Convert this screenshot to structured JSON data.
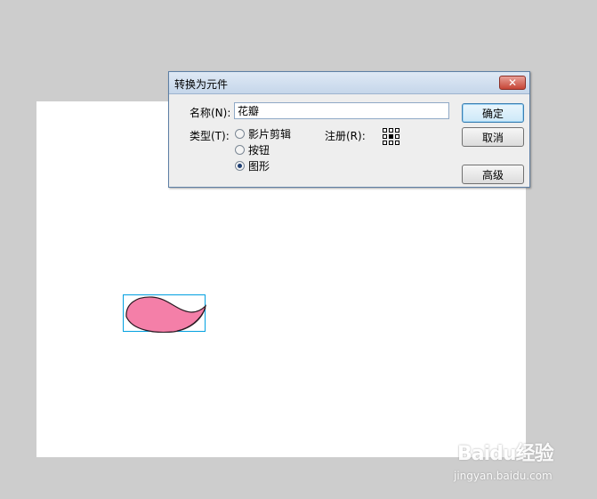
{
  "dialog": {
    "title": "转换为元件",
    "close_glyph": "✕",
    "name_label": "名称(N):",
    "name_value": "花瓣",
    "type_label": "类型(T):",
    "types": [
      {
        "label": "影片剪辑",
        "selected": false
      },
      {
        "label": "按钮",
        "selected": false
      },
      {
        "label": "图形",
        "selected": true
      }
    ],
    "registration_label": "注册(R):",
    "registration_icon": "registration-grid-icon",
    "buttons": {
      "ok": "确定",
      "cancel": "取消",
      "advanced": "高级"
    }
  },
  "stage": {
    "petal_fill": "#f47fa8",
    "selection_color": "#00a0e0"
  },
  "watermark": {
    "brand": "Baidu经验",
    "url": "jingyan.baidu.com"
  }
}
